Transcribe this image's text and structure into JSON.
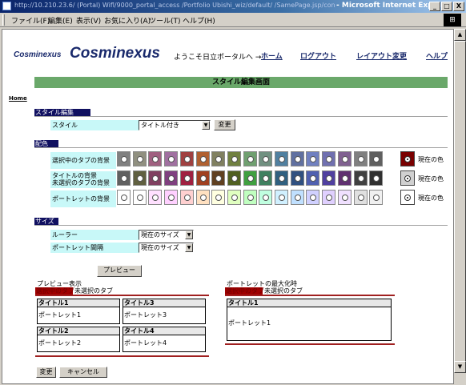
{
  "window": {
    "url": "http://10.210.23.6/ (Portal) Wifl/9000_portal_access /Portfolio Ubishi_wiz/default/ /SamePage.jsp/controls",
    "title": "- Microsoft Internet Explorer",
    "min": "_",
    "max": "□",
    "close": "X"
  },
  "menu": {
    "items": [
      "ファイル(F)",
      "編集(E)",
      "表示(V)",
      "お気に入り(A)",
      "ツール(T)",
      "ヘルプ(H)"
    ]
  },
  "header": {
    "logo_small": "Cosminexus",
    "logo_big": "Cosminexus",
    "welcome": "ようこそ日立ポータルへ →",
    "links": [
      "ホーム",
      "ログアウト",
      "レイアウト変更",
      "ヘルプ"
    ],
    "home_link": "Home"
  },
  "page": {
    "title": "スタイル編集画面"
  },
  "style_section": {
    "heading": "スタイル編集",
    "label": "スタイル",
    "select_value": "タイトル付き",
    "change_button": "変更"
  },
  "color_section": {
    "heading": "配色",
    "rows": [
      {
        "label": "選択中のタブの背景",
        "current_label": "現在の色",
        "current_color": "#7a0000",
        "colors": [
          "#808080",
          "#909080",
          "#a06080",
          "#a070a0",
          "#a04040",
          "#b06030",
          "#808060",
          "#708040",
          "#70a070",
          "#709080",
          "#5080a0",
          "#6070a0",
          "#7080c0",
          "#7070b0",
          "#806090",
          "#808080",
          "#606060"
        ]
      },
      {
        "label": "タイトルの背景",
        "label2": "未選択のタブの背景",
        "current_label": "現在の色",
        "current_color": "#d0d0d0",
        "colors": [
          "#606060",
          "#606040",
          "#804060",
          "#804080",
          "#a02040",
          "#a04020",
          "#604020",
          "#506020",
          "#40a040",
          "#408060",
          "#306080",
          "#305080",
          "#5060b0",
          "#5040a0",
          "#603070",
          "#404040",
          "#303030"
        ]
      },
      {
        "label": "ポートレットの背景",
        "current_label": "現在の色",
        "current_color": "#ffffff",
        "colors": [
          "#ffffff",
          "#ffffff",
          "#ffe0ff",
          "#ffd0ff",
          "#ffd0d0",
          "#ffe0c0",
          "#ffffe0",
          "#e0ffc0",
          "#c0ffc0",
          "#c0ffe0",
          "#d0f0ff",
          "#c0e0ff",
          "#d0d0ff",
          "#e0d0ff",
          "#f0e0ff",
          "#e0e0e0",
          "#f0f0f0"
        ]
      }
    ]
  },
  "size_section": {
    "heading": "サイズ",
    "ruler_label": "ルーラー",
    "ruler_value": "現在のサイズ",
    "spacing_label": "ポートレット間隔",
    "spacing_value": "現在のサイズ"
  },
  "preview": {
    "button": "プレビュー",
    "left_title": "プレビュー表示",
    "right_title": "ポートレットの最大化時",
    "tab_selected": "選択中のタブ",
    "tab_unselected": "未選択のタブ",
    "portlets": [
      {
        "title": "タイトル1",
        "body": "ポートレット1"
      },
      {
        "title": "タイトル3",
        "body": "ポートレット3"
      },
      {
        "title": "タイトル2",
        "body": "ポートレット2"
      },
      {
        "title": "タイトル4",
        "body": "ポートレット4"
      }
    ],
    "max_portlet": {
      "title": "タイトル1",
      "body": "ポートレット1"
    }
  },
  "footer": {
    "change_button": "変更",
    "cancel_button": "キャンセル"
  }
}
